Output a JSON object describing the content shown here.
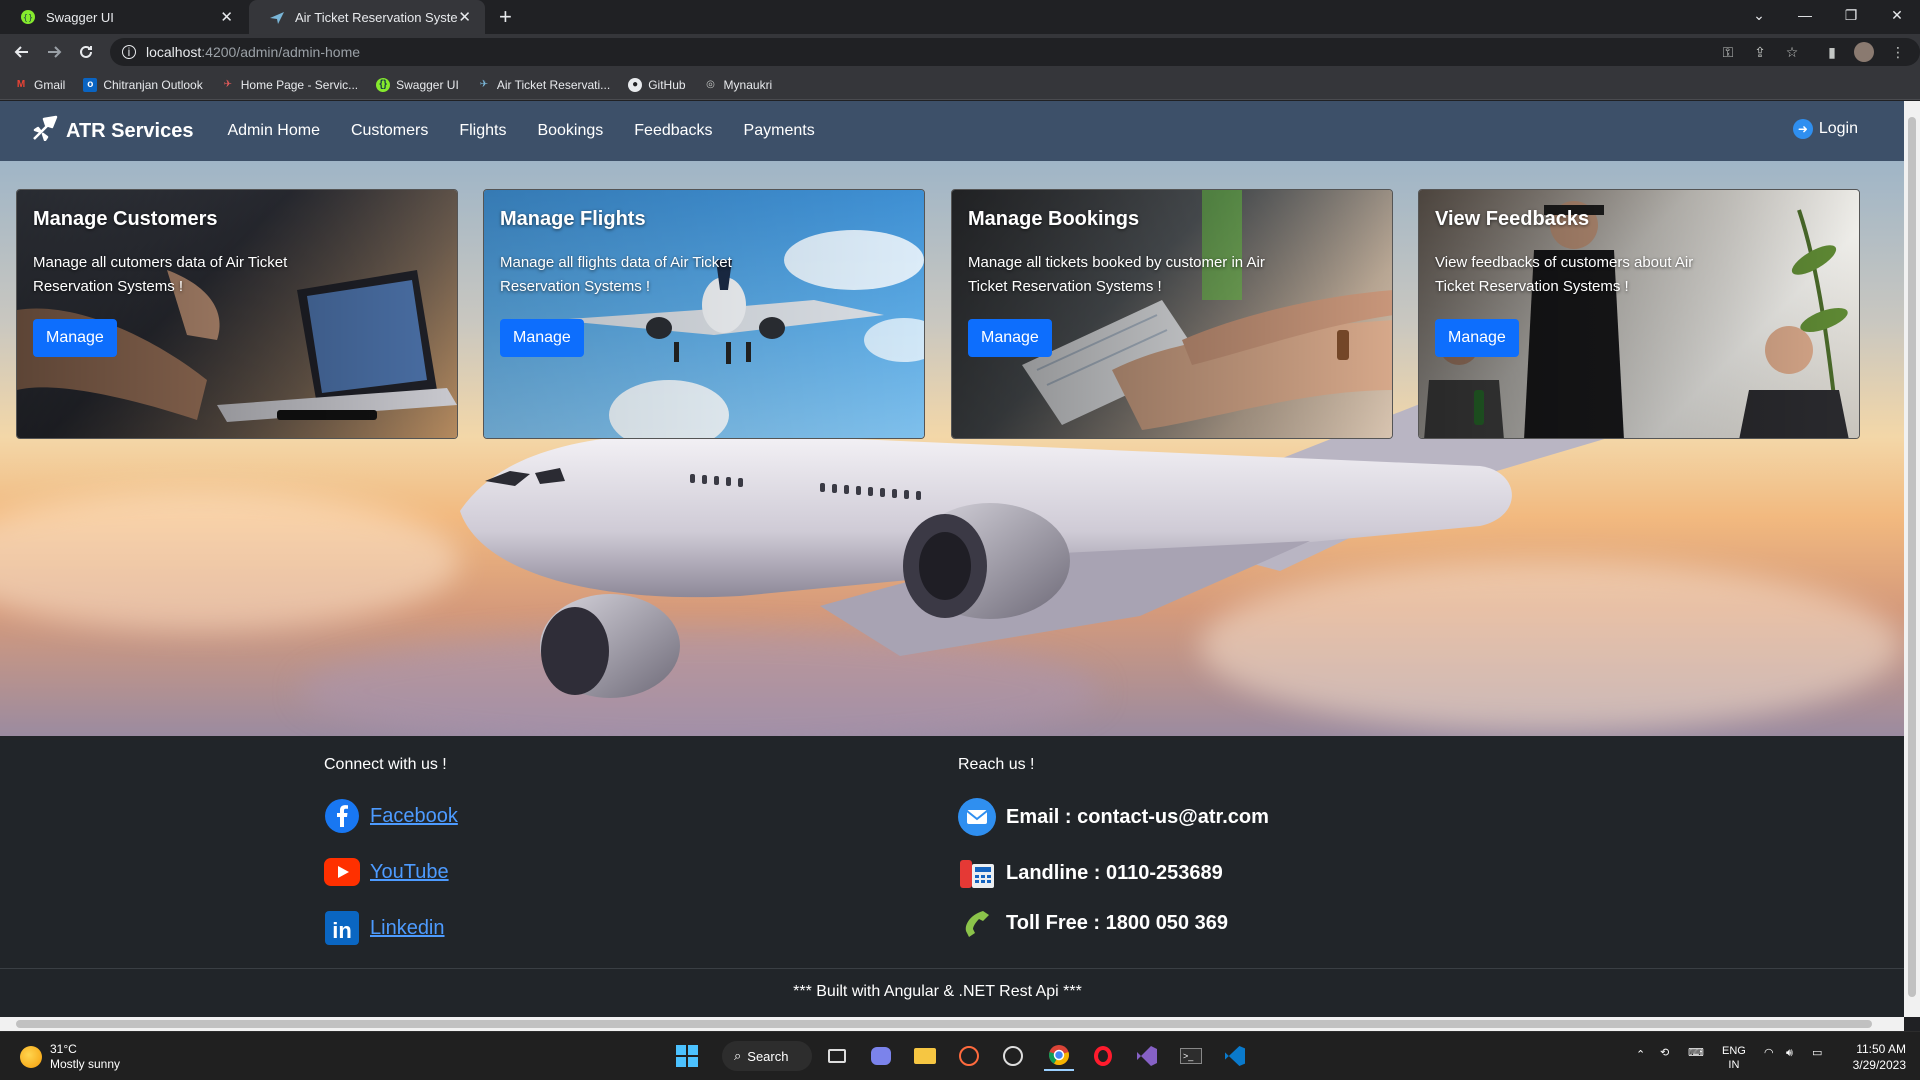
{
  "browser": {
    "tabs": [
      {
        "title": "Swagger UI"
      },
      {
        "title": "Air Ticket Reservation System"
      }
    ],
    "url_host": "localhost",
    "url_path": ":4200/admin/admin-home",
    "bookmarks": [
      {
        "label": "Gmail",
        "icon": "gmail-icon"
      },
      {
        "label": "Chitranjan Outlook",
        "icon": "outlook-icon"
      },
      {
        "label": "Home Page - Servic...",
        "icon": "servicenow-icon"
      },
      {
        "label": "Swagger UI",
        "icon": "swagger-icon"
      },
      {
        "label": "Air Ticket Reservati...",
        "icon": "plane-icon"
      },
      {
        "label": "GitHub",
        "icon": "github-icon"
      },
      {
        "label": "Mynaukri",
        "icon": "globe-icon"
      }
    ]
  },
  "navbar": {
    "brand": "ATR Services",
    "links": [
      "Admin Home",
      "Customers",
      "Flights",
      "Bookings",
      "Feedbacks",
      "Payments"
    ],
    "login": "Login"
  },
  "cards": [
    {
      "title": "Manage Customers",
      "text": "Manage all cutomers data of Air Ticket Reservation Systems !",
      "button": "Manage"
    },
    {
      "title": "Manage Flights",
      "text": "Manage all flights data of Air Ticket Reservation Systems !",
      "button": "Manage"
    },
    {
      "title": "Manage Bookings",
      "text": "Manage all tickets booked by customer in Air Ticket Reservation Systems !",
      "button": "Manage"
    },
    {
      "title": "View Feedbacks",
      "text": "View feedbacks of customers about Air Ticket Reservation Systems !",
      "button": "Manage"
    }
  ],
  "footer": {
    "connect_title": "Connect with us !",
    "social": [
      "Facebook",
      "YouTube",
      "Linkedin"
    ],
    "reach_title": "Reach us !",
    "email": "Email : contact-us@atr.com",
    "landline": "Landline : 0110-253689",
    "tollfree": "Toll Free : 1800 050 369",
    "built": "*** Built with Angular & .NET Rest Api ***"
  },
  "taskbar": {
    "temperature": "31°C",
    "weather": "Mostly sunny",
    "search": "Search",
    "lang_top": "ENG",
    "lang_bottom": "IN",
    "time": "11:50 AM",
    "date": "3/29/2023"
  },
  "colors": {
    "navbar": "#3d5069",
    "button": "#0d6efd",
    "footer": "#212529",
    "link": "#4d9bff"
  }
}
